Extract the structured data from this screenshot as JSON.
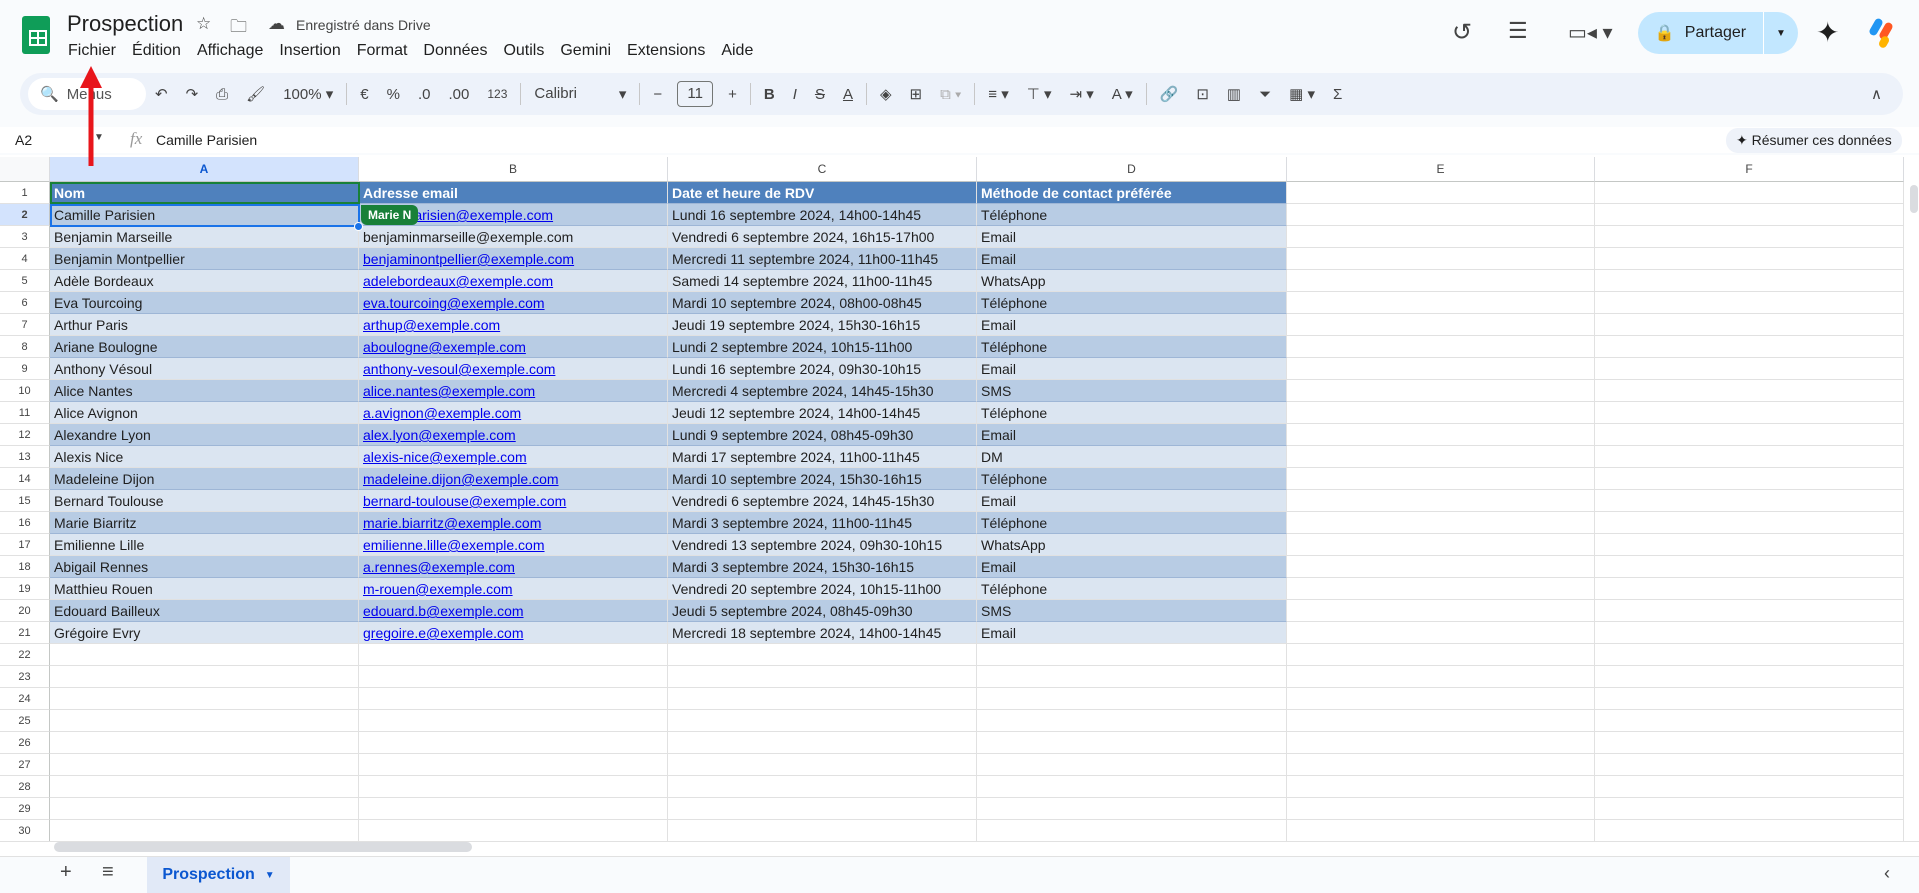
{
  "app": {
    "title": "Prospection",
    "saved_status": "Enregistré dans Drive",
    "share_label": "Partager",
    "brand_color": "#0f9d58",
    "icons": [
      "star-icon",
      "move-folder-icon",
      "cloud-saved-icon",
      "history-icon",
      "comments-icon",
      "meet-icon",
      "lock-icon",
      "gemini-icon"
    ]
  },
  "menu": [
    "Fichier",
    "Édition",
    "Affichage",
    "Insertion",
    "Format",
    "Données",
    "Outils",
    "Gemini",
    "Extensions",
    "Aide"
  ],
  "toolbar": {
    "search_placeholder": "Menus",
    "zoom": "100%",
    "currency": "€",
    "percent": "%",
    "dec_decrease": ".0",
    "dec_increase": ".00",
    "number_format": "123",
    "font": "Calibri",
    "font_size": "11",
    "bold": "B",
    "italic": "I",
    "strike": "S",
    "text_color": "A",
    "sum": "Σ"
  },
  "formula_bar": {
    "cell_ref": "A2",
    "fx": "fx",
    "value": "Camille Parisien",
    "summarize": "Résumer ces données"
  },
  "columns": [
    "A",
    "B",
    "C",
    "D",
    "E",
    "F"
  ],
  "table": {
    "header": [
      "Nom",
      "Adresse email",
      "Date et heure de RDV",
      "Méthode de contact préférée"
    ],
    "rows": [
      [
        "Camille Parisien",
        "camilleparisien@exemple.com",
        "Lundi 16 septembre 2024, 14h00-14h45",
        "Téléphone"
      ],
      [
        "Benjamin Marseille",
        "benjaminmarseille@exemple.com",
        "Vendredi 6 septembre 2024, 16h15-17h00",
        "Email"
      ],
      [
        "Benjamin Montpellier",
        "benjaminontpellier@exemple.com",
        "Mercredi 11 septembre 2024, 11h00-11h45",
        "Email"
      ],
      [
        "Adèle Bordeaux",
        "adelebordeaux@exemple.com",
        "Samedi 14 septembre 2024, 11h00-11h45",
        "WhatsApp"
      ],
      [
        "Eva Tourcoing",
        "eva.tourcoing@exemple.com",
        "Mardi 10 septembre 2024, 08h00-08h45",
        "Téléphone"
      ],
      [
        "Arthur Paris",
        "arthup@exemple.com",
        "Jeudi 19 septembre 2024, 15h30-16h15",
        "Email"
      ],
      [
        "Ariane Boulogne",
        "aboulogne@exemple.com",
        "Lundi 2 septembre 2024, 10h15-11h00",
        "Téléphone"
      ],
      [
        "Anthony Vésoul",
        "anthony-vesoul@exemple.com",
        "Lundi 16 septembre 2024, 09h30-10h15",
        "Email"
      ],
      [
        "Alice Nantes",
        "alice.nantes@exemple.com",
        "Mercredi 4 septembre 2024, 14h45-15h30",
        "SMS"
      ],
      [
        "Alice Avignon",
        "a.avignon@exemple.com",
        "Jeudi 12 septembre 2024, 14h00-14h45",
        "Téléphone"
      ],
      [
        "Alexandre Lyon",
        "alex.lyon@exemple.com",
        "Lundi 9 septembre 2024, 08h45-09h30",
        "Email"
      ],
      [
        "Alexis Nice",
        "alexis-nice@exemple.com",
        "Mardi 17 septembre 2024, 11h00-11h45",
        "DM"
      ],
      [
        "Madeleine Dijon",
        "madeleine.dijon@exemple.com",
        "Mardi 10 septembre 2024, 15h30-16h15",
        "Téléphone"
      ],
      [
        "Bernard Toulouse",
        "bernard-toulouse@exemple.com",
        "Vendredi 6 septembre 2024, 14h45-15h30",
        "Email"
      ],
      [
        "Marie Biarritz",
        "marie.biarritz@exemple.com",
        "Mardi 3 septembre 2024, 11h00-11h45",
        "Téléphone"
      ],
      [
        "Emilienne Lille",
        "emilienne.lille@exemple.com",
        "Vendredi 13 septembre 2024, 09h30-10h15",
        "WhatsApp"
      ],
      [
        "Abigail Rennes",
        "a.rennes@exemple.com",
        "Mardi 3 septembre 2024, 15h30-16h15",
        "Email"
      ],
      [
        "Matthieu Rouen",
        "m-rouen@exemple.com",
        "Vendredi 20 septembre 2024, 10h15-11h00",
        "Téléphone"
      ],
      [
        "Edouard Bailleux",
        "edouard.b@exemple.com",
        "Jeudi 5 septembre 2024, 08h45-09h30",
        "SMS"
      ],
      [
        "Grégoire Evry",
        "gregoire.e@exemple.com",
        "Mercredi 18 septembre 2024, 14h00-14h45",
        "Email"
      ]
    ],
    "non_link_email_rows": [
      1
    ],
    "colors": {
      "header": "#4f81bd",
      "band_dark": "#b8cce4",
      "band_light": "#dbe5f1",
      "link": "#0000ee"
    }
  },
  "row_count": 30,
  "collaborator": {
    "name": "Marie N",
    "color": "#188038"
  },
  "sheets": [
    {
      "name": "Prospection",
      "active": true
    }
  ],
  "annotation": {
    "type": "red-arrow",
    "points_to": "Fichier",
    "color": "#e8151b"
  }
}
